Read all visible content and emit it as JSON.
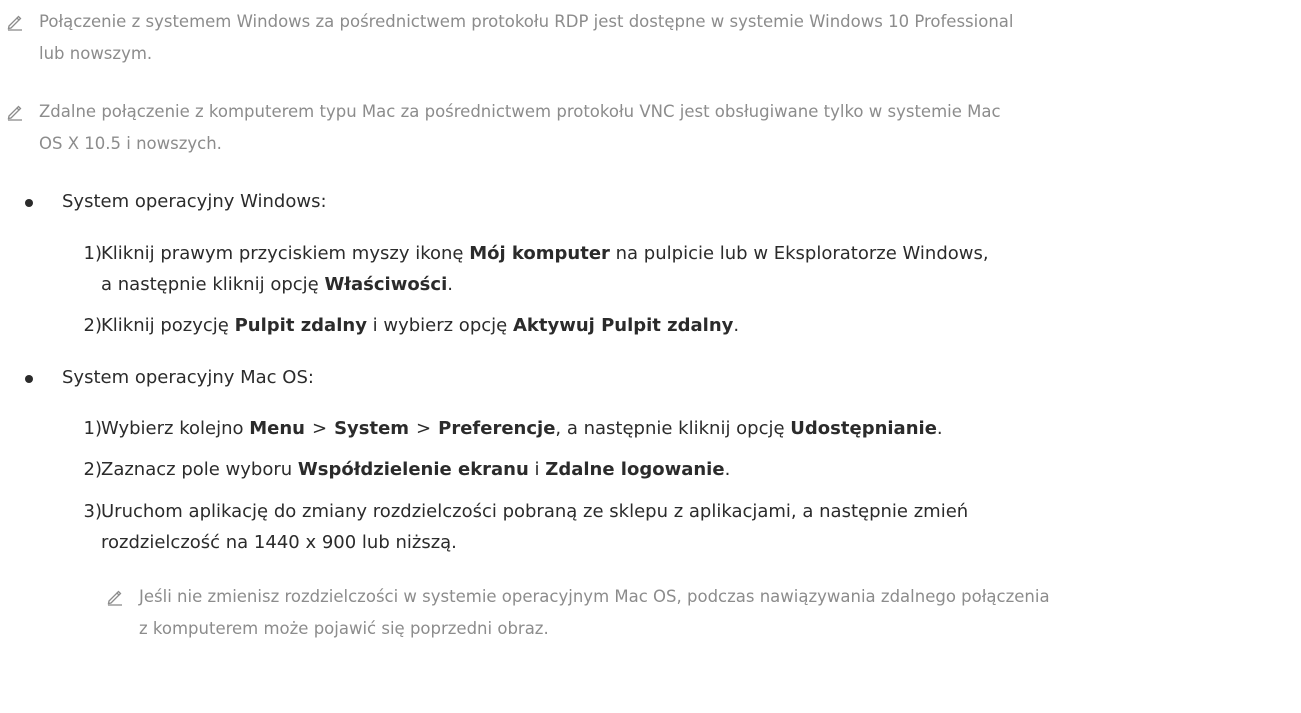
{
  "notes": [
    {
      "line1": "Połączenie z systemem Windows za pośrednictwem protokołu RDP jest dostępne w systemie Windows 10 Professional",
      "line2": "lub nowszym."
    },
    {
      "line1": "Zdalne połączenie z komputerem typu Mac za pośrednictwem protokołu VNC jest obsługiwane tylko w systemie Mac",
      "line2": "OS X 10.5 i nowszych."
    }
  ],
  "sections": [
    {
      "title": "System operacyjny Windows:",
      "steps": [
        {
          "num": "1)",
          "a": "Kliknij prawym przyciskiem myszy ikonę ",
          "b": "Mój komputer",
          "c": " na pulpicie lub w Eksploratorze Windows,",
          "d": "a następnie kliknij opcję ",
          "e": "Właściwości",
          "f": "."
        },
        {
          "num": "2)",
          "a": "Kliknij pozycję ",
          "b": "Pulpit zdalny",
          "c": " i wybierz opcję ",
          "d": "Aktywuj Pulpit zdalny",
          "e": "."
        }
      ]
    },
    {
      "title": "System operacyjny Mac OS:",
      "steps": [
        {
          "num": "1)",
          "a": "Wybierz kolejno ",
          "menu": "Menu",
          "sep": ">",
          "system": "System",
          "pref": "Preferencje",
          "c": ", a następnie kliknij opcję ",
          "d": "Udostępnianie",
          "e": "."
        },
        {
          "num": "2)",
          "a": "Zaznacz pole wyboru ",
          "b": "Współdzielenie ekranu",
          "c": " i ",
          "d": "Zdalne logowanie",
          "e": "."
        },
        {
          "num": "3)",
          "line1": "Uruchom aplikację do zmiany rozdzielczości pobraną ze sklepu z aplikacjami, a następnie zmień",
          "line2": "rozdzielczość na 1440 x 900 lub niższą."
        }
      ],
      "subnote": {
        "line1": "Jeśli nie zmienisz rozdzielczości w systemie operacyjnym Mac OS, podczas nawiązywania zdalnego połączenia",
        "line2": "z komputerem może pojawić się poprzedni obraz."
      }
    }
  ]
}
